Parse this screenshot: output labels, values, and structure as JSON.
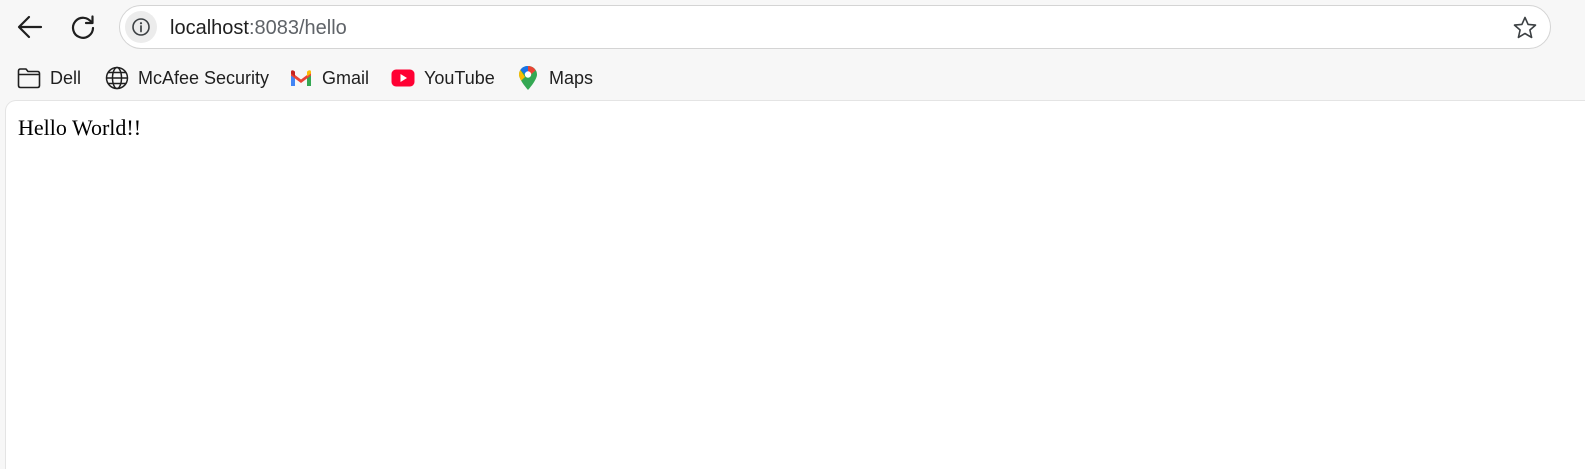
{
  "browser": {
    "nav": {
      "back_icon": "arrow-left-icon",
      "reload_icon": "reload-icon"
    },
    "omnibox": {
      "site_info_icon": "info-icon",
      "url_host": "localhost",
      "url_rest": ":8083/hello",
      "bookmark_star_icon": "star-icon"
    },
    "bookmarks": [
      {
        "label": "Dell",
        "icon": "folder-icon"
      },
      {
        "label": "McAfee Security",
        "icon": "globe-icon"
      },
      {
        "label": "Gmail",
        "icon": "gmail-icon"
      },
      {
        "label": "YouTube",
        "icon": "youtube-icon"
      },
      {
        "label": "Maps",
        "icon": "maps-pin-icon"
      }
    ]
  },
  "page": {
    "text": "Hello World!!"
  },
  "colors": {
    "toolbar_bg": "#f7f7f7",
    "page_bg": "#ffffff",
    "youtube_red": "#ff0033"
  }
}
